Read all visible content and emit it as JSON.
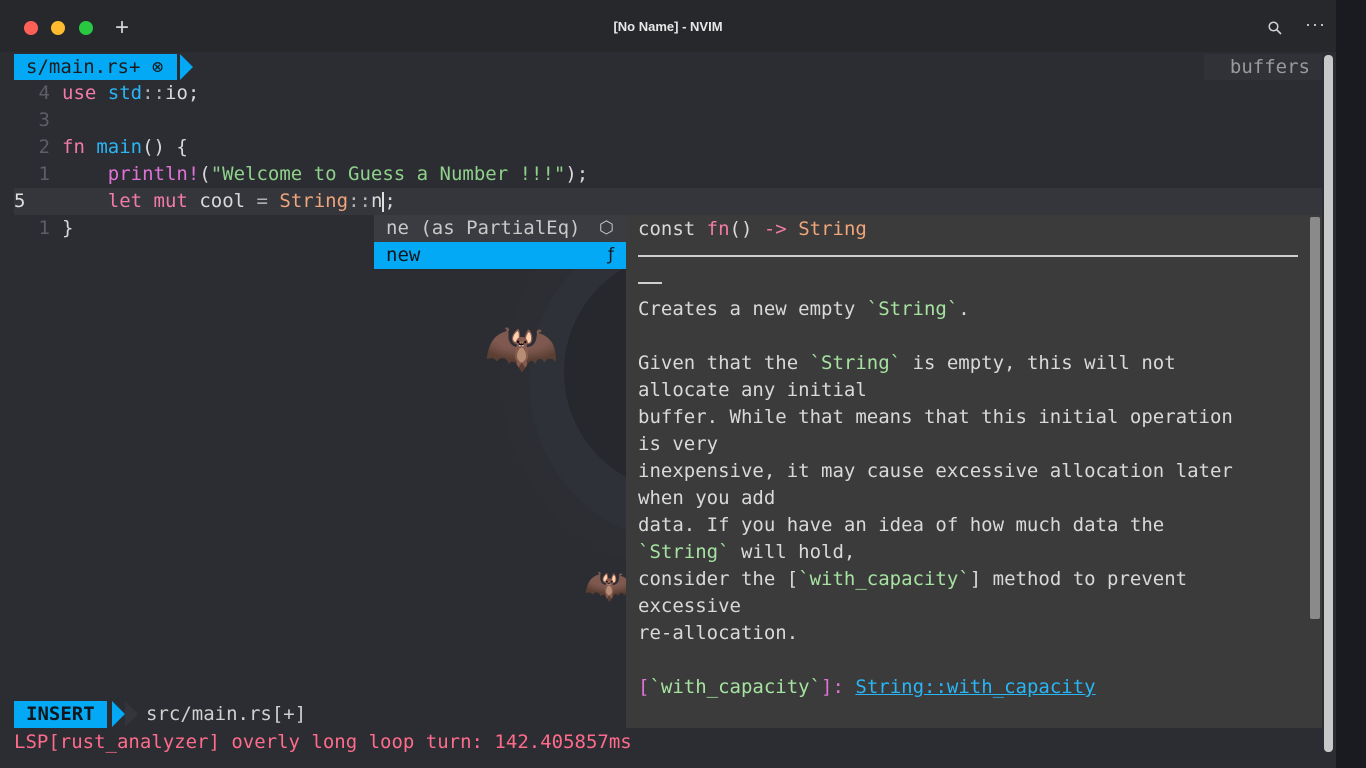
{
  "window": {
    "title": "[No Name] - NVIM",
    "new_tab_label": "+",
    "more_label": "···"
  },
  "tabline": {
    "active_tab": "s/main.rs+ ⊗",
    "buffers_label": "buffers"
  },
  "editor": {
    "lines": [
      {
        "num": "4",
        "parts": [
          [
            "kw",
            "use"
          ],
          [
            "plain",
            " "
          ],
          [
            "id",
            "std"
          ],
          [
            "op",
            "::"
          ],
          [
            "plain",
            "io;"
          ]
        ]
      },
      {
        "num": "3",
        "parts": []
      },
      {
        "num": "2",
        "parts": [
          [
            "kw",
            "fn"
          ],
          [
            "plain",
            " "
          ],
          [
            "fn",
            "main"
          ],
          [
            "plain",
            "() {"
          ]
        ]
      },
      {
        "num": "1",
        "parts": [
          [
            "plain",
            "    "
          ],
          [
            "mac",
            "println!"
          ],
          [
            "plain",
            "("
          ],
          [
            "str",
            "\"Welcome to Guess a Number !!!\""
          ],
          [
            "plain",
            ");"
          ]
        ]
      },
      {
        "num": "5",
        "current": true,
        "parts": [
          [
            "plain",
            "    "
          ],
          [
            "kw",
            "let"
          ],
          [
            "plain",
            " "
          ],
          [
            "kw",
            "mut"
          ],
          [
            "plain",
            " cool "
          ],
          [
            "op",
            "="
          ],
          [
            "plain",
            " "
          ],
          [
            "type",
            "String"
          ],
          [
            "op",
            "::"
          ],
          [
            "plain",
            "n"
          ],
          [
            "cursor",
            ""
          ],
          [
            "plain",
            ";"
          ]
        ]
      },
      {
        "num": "1",
        "parts": [
          [
            "plain",
            "}"
          ]
        ]
      }
    ]
  },
  "completion": {
    "items": [
      {
        "label": "ne (as PartialEq)",
        "icon": "⬡",
        "icon_name": "cube-icon",
        "selected": false
      },
      {
        "label": "new",
        "icon": "ƒ",
        "icon_name": "function-icon",
        "selected": true
      }
    ]
  },
  "docs": {
    "signature_parts": [
      [
        "plain",
        "const "
      ],
      [
        "kw",
        "fn"
      ],
      [
        "plain",
        "() "
      ],
      [
        "kw",
        "->"
      ],
      [
        "plain",
        " "
      ],
      [
        "type",
        "String"
      ]
    ],
    "body": [
      [
        [
          "plain",
          "Creates a new empty "
        ],
        [
          "tick",
          "`String`"
        ],
        [
          "plain",
          "."
        ]
      ],
      [],
      [
        [
          "plain",
          "Given that the "
        ],
        [
          "tick",
          "`String`"
        ],
        [
          "plain",
          " is empty, this will not"
        ]
      ],
      [
        [
          "plain",
          "allocate any initial"
        ]
      ],
      [
        [
          "plain",
          "buffer. While that means that this initial operation"
        ]
      ],
      [
        [
          "plain",
          "is very"
        ]
      ],
      [
        [
          "plain",
          "inexpensive, it may cause excessive allocation later"
        ]
      ],
      [
        [
          "plain",
          "when you add"
        ]
      ],
      [
        [
          "plain",
          "data. If you have an idea of how much data the"
        ]
      ],
      [
        [
          "tick",
          "`String`"
        ],
        [
          "plain",
          " will hold,"
        ]
      ],
      [
        [
          "plain",
          "consider the ["
        ],
        [
          "tick",
          "`with_capacity`"
        ],
        [
          "plain",
          "] method to prevent"
        ]
      ],
      [
        [
          "plain",
          "excessive"
        ]
      ],
      [
        [
          "plain",
          "re-allocation."
        ]
      ],
      [],
      [
        [
          "ref",
          "["
        ],
        [
          "tick",
          "`with_capacity`"
        ],
        [
          "ref",
          "]: "
        ],
        [
          "link",
          "String::with_capacity"
        ]
      ]
    ]
  },
  "statusline": {
    "mode": "INSERT",
    "file": "src/main.rs[+]"
  },
  "cmdline": {
    "message": "LSP[rust_analyzer] overly long loop turn: 142.405857ms"
  },
  "colors": {
    "accent": "#03a9f4",
    "keyword": "#f47ba7",
    "string": "#8fd18a",
    "type": "#f0a57a",
    "error": "#ff6b8a"
  }
}
